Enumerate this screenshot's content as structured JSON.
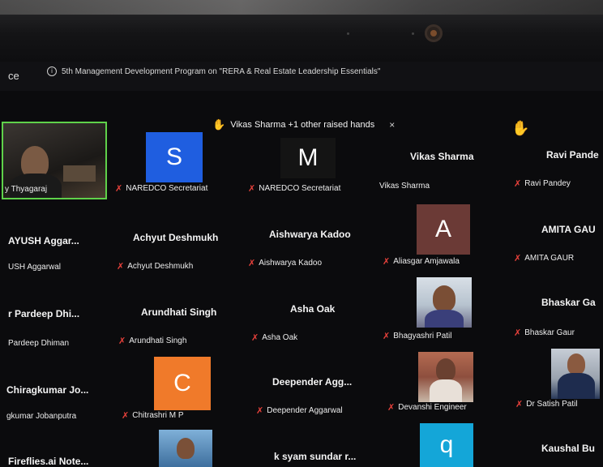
{
  "topbar": {
    "left_tab": "ce",
    "info_text": "5th Management Development Program on \"RERA & Real Estate Leadership Essentials\""
  },
  "raised_hands": {
    "text": "Vikas Sharma +1 other raised hands",
    "close": "×"
  },
  "icons": {
    "hand": "✋",
    "mic_off": "✗",
    "info": "i"
  },
  "tiles": {
    "r1": [
      {
        "tag": "y Thyagaraj"
      },
      {
        "avatar_letter": "S",
        "avatar_color": "#1f5ee0",
        "tag": "NAREDCO Secretariat"
      },
      {
        "avatar_letter": "M",
        "avatar_color": "#141414",
        "tag": "NAREDCO Secretariat"
      },
      {
        "big": "Vikas Sharma",
        "tag": "Vikas Sharma"
      },
      {
        "big": "Ravi Pande",
        "tag": "Ravi Pandey"
      }
    ],
    "r2": [
      {
        "big": "AYUSH  Aggar...",
        "tag": "USH Aggarwal"
      },
      {
        "big": "Achyut Deshmukh",
        "tag": "Achyut Deshmukh"
      },
      {
        "big": "Aishwarya Kadoo",
        "tag": "Aishwarya Kadoo"
      },
      {
        "avatar_letter": "A",
        "avatar_color": "#6b3a36",
        "tag": "Aliasgar Amjawala"
      },
      {
        "big": "AMITA GAU",
        "tag": "AMITA GAUR"
      }
    ],
    "r3": [
      {
        "big": "r Pardeep Dhi...",
        "tag": "Pardeep Dhiman"
      },
      {
        "big": "Arundhati Singh",
        "tag": "Arundhati Singh"
      },
      {
        "big": "Asha Oak",
        "tag": "Asha Oak"
      },
      {
        "tag": "Bhagyashri Patil"
      },
      {
        "big": "Bhaskar Ga",
        "tag": "Bhaskar Gaur"
      }
    ],
    "r4": [
      {
        "big": "Chiragkumar  Jo...",
        "tag": "gkumar Jobanputra"
      },
      {
        "avatar_letter": "C",
        "avatar_color": "#f07a2a",
        "tag": "Chitrashri M P"
      },
      {
        "big": "Deepender  Agg...",
        "tag": "Deepender Aggarwal"
      },
      {
        "tag": "Devanshi Engineer"
      },
      {
        "tag": "Dr Satish Patil"
      }
    ],
    "r5": [
      {
        "big": "Fireflies.ai  Note..."
      },
      {},
      {
        "big": "k syam sundar r..."
      },
      {
        "avatar_letter": "q",
        "avatar_color": "#14a6d8"
      },
      {
        "big": "Kaushal Bu"
      }
    ]
  }
}
